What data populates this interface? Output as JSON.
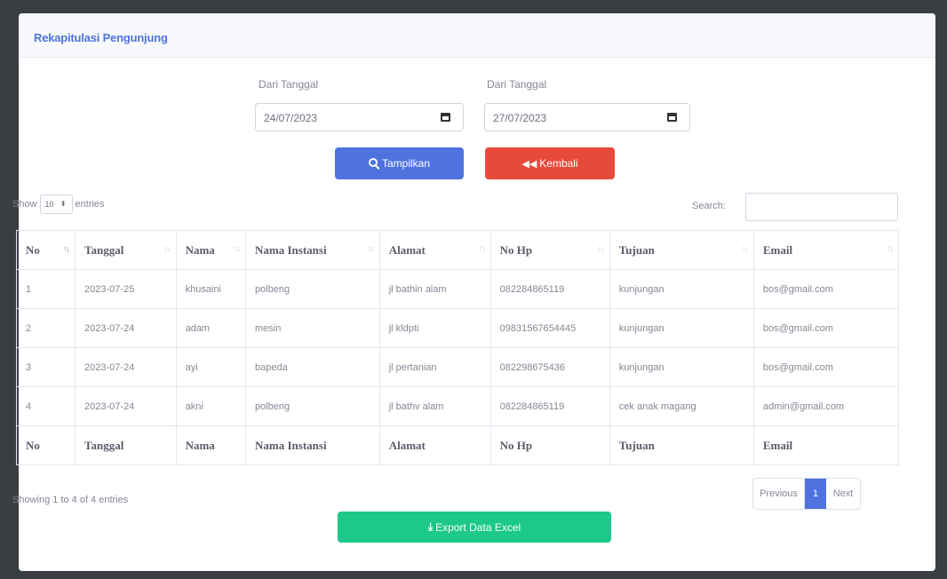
{
  "card": {
    "title": "Rekapitulasi Pengunjung"
  },
  "filter": {
    "from_label": "Dari Tanggal",
    "from_value": "24/07/2023",
    "to_label": "Dari Tanggal",
    "to_value": "27/07/2023",
    "show_button": "Tampilkan",
    "back_button": "Kembali"
  },
  "table_controls": {
    "show_prefix": "Show",
    "length_value": "10",
    "show_suffix": "entries",
    "search_label": "Search:"
  },
  "table": {
    "headers": [
      "No",
      "Tanggal",
      "Nama",
      "Nama Instansi",
      "Alamat",
      "No Hp",
      "Tujuan",
      "Email"
    ],
    "rows": [
      [
        "1",
        "2023-07-25",
        "khusaini",
        "polbeng",
        "jl bathin alam",
        "082284865119",
        "kunjungan",
        "bos@gmail.com"
      ],
      [
        "2",
        "2023-07-24",
        "adam",
        "mesin",
        "jl kldpti",
        "09831567654445",
        "kunjungan",
        "bos@gmail.com"
      ],
      [
        "3",
        "2023-07-24",
        "ayi",
        "bapeda",
        "jl pertanian",
        "082298675436",
        "kunjungan",
        "bos@gmail.com"
      ],
      [
        "4",
        "2023-07-24",
        "akni",
        "polbeng",
        "jl bathv alam",
        "082284865119",
        "cek anak magang",
        "admin@gmail.com"
      ]
    ]
  },
  "footer": {
    "info": "Showing 1 to 4 of 4 entries",
    "previous": "Previous",
    "current_page": "1",
    "next": "Next",
    "export_button": "Export Data Excel"
  },
  "icons": {
    "search": "search-icon",
    "back": "backward-icon",
    "calendar": "calendar-icon",
    "download": "download-icon"
  },
  "colors": {
    "primary": "#4e73df",
    "danger": "#e74a3b",
    "success": "#1cc88a"
  }
}
